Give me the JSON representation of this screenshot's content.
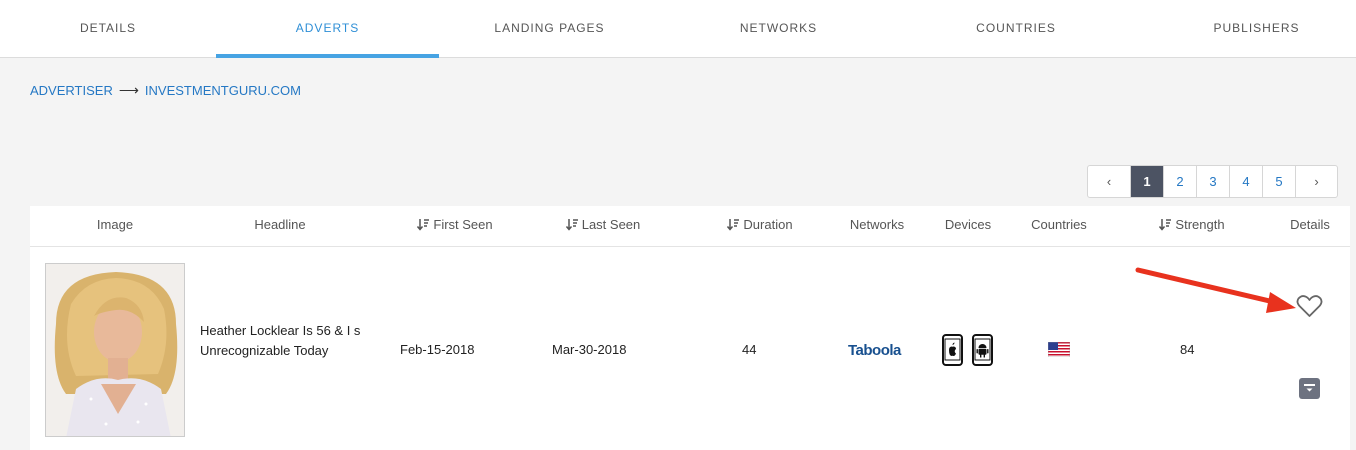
{
  "tabs": [
    {
      "label": "DETAILS",
      "active": false
    },
    {
      "label": "ADVERTS",
      "active": true
    },
    {
      "label": "LANDING PAGES",
      "active": false
    },
    {
      "label": "NETWORKS",
      "active": false
    },
    {
      "label": "COUNTRIES",
      "active": false
    },
    {
      "label": "PUBLISHERS",
      "active": false
    }
  ],
  "breadcrumb": {
    "root": "ADVERTISER",
    "separator": "⟶",
    "current": "INVESTMENTGURU.COM"
  },
  "pagination": {
    "prev": "‹",
    "next": "›",
    "pages": [
      "1",
      "2",
      "3",
      "4",
      "5"
    ],
    "current": "1"
  },
  "table": {
    "columns": [
      "Image",
      "Headline",
      "First Seen",
      "Last Seen",
      "Duration",
      "Networks",
      "Devices",
      "Countries",
      "Strength",
      "Details"
    ],
    "rows": [
      {
        "headline": "Heather Locklear Is 56 & I s Unrecognizable Today",
        "first_seen": "Feb-15-2018",
        "last_seen": "Mar-30-2018",
        "duration": "44",
        "network": "Taboola",
        "devices": [
          "apple-phone-icon",
          "android-phone-icon"
        ],
        "country": "us-flag-icon",
        "strength": "84",
        "favorite": false
      }
    ]
  },
  "colors": {
    "accent": "#46a3e3",
    "link": "#2578c4",
    "annotation_arrow": "#e8321e",
    "active_page": "#4c5363"
  }
}
